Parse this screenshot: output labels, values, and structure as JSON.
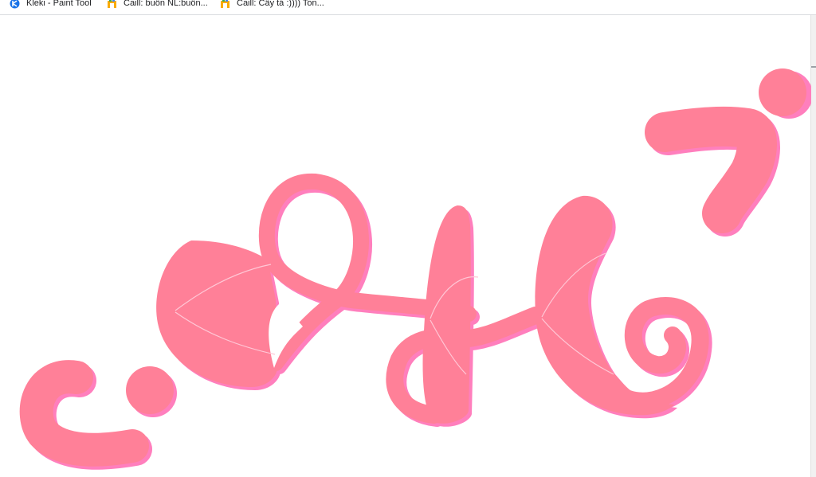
{
  "bookmarks": [
    {
      "label": "Kleki - Paint Tool",
      "icon": "kleki-icon"
    },
    {
      "label": "Caill: buồn NL:buồn...",
      "icon": "folder-icon"
    },
    {
      "label": "Caill: Cây tá :)))) Ton...",
      "icon": "folder-icon"
    }
  ],
  "colors": {
    "ink_main": "#ff8098",
    "ink_shadow": "#ff7fbd",
    "stroke_highlight": "#ffc7d6"
  }
}
